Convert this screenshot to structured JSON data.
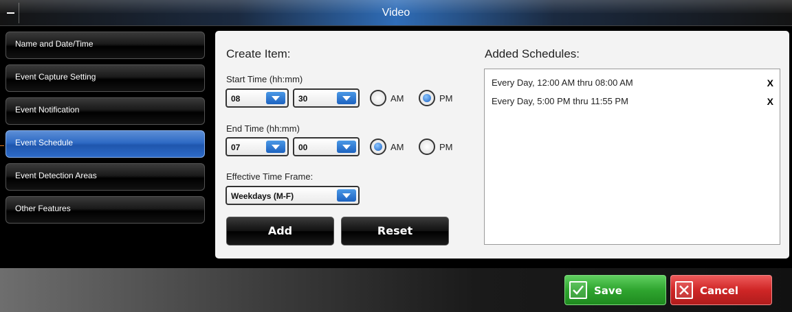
{
  "window": {
    "title": "Video"
  },
  "sidebar": {
    "items": [
      {
        "label": "Name and Date/Time",
        "active": false
      },
      {
        "label": "Event Capture Setting",
        "active": false
      },
      {
        "label": "Event Notification",
        "active": false
      },
      {
        "label": "Event Schedule",
        "active": true
      },
      {
        "label": "Event Detection Areas",
        "active": false
      },
      {
        "label": "Other Features",
        "active": false
      }
    ]
  },
  "create": {
    "heading": "Create Item:",
    "start_label": "Start Time (hh:mm)",
    "start_hour": "08",
    "start_minute": "30",
    "start_ampm": "PM",
    "end_label": "End Time (hh:mm)",
    "end_hour": "07",
    "end_minute": "00",
    "end_ampm": "AM",
    "am_label": "AM",
    "pm_label": "PM",
    "timeframe_label": "Effective Time Frame:",
    "timeframe_value": "Weekdays (M-F)",
    "add_label": "Add",
    "reset_label": "Reset"
  },
  "schedules": {
    "heading": "Added Schedules:",
    "remove_label": "X",
    "items": [
      "Every Day, 12:00 AM thru 08:00 AM",
      "Every Day, 5:00 PM thru 11:55 PM"
    ]
  },
  "footer": {
    "save_label": "Save",
    "cancel_label": "Cancel"
  },
  "colors": {
    "accent": "#2e6ac4",
    "save": "#2fa52f",
    "cancel": "#cf2626"
  }
}
